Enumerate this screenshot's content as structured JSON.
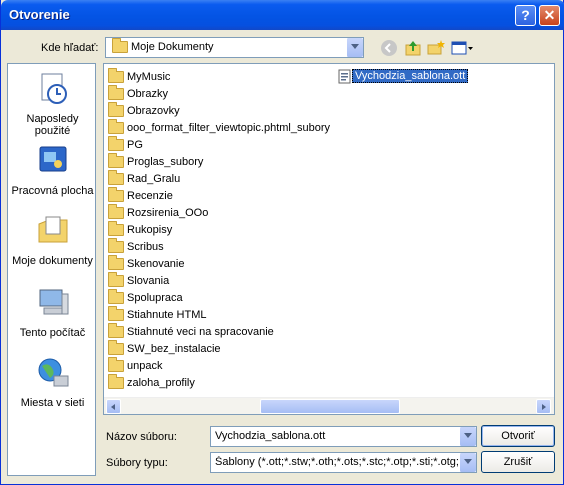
{
  "window": {
    "title": "Otvorenie",
    "help_glyph": "?",
    "close_glyph": "✕"
  },
  "lookin": {
    "label": "Kde hľadať:",
    "value": "Moje Dokumenty"
  },
  "places": [
    {
      "label": "Naposledy použité",
      "icon": "recent-documents-icon"
    },
    {
      "label": "Pracovná plocha",
      "icon": "desktop-icon"
    },
    {
      "label": "Moje dokumenty",
      "icon": "my-documents-icon"
    },
    {
      "label": "Tento počítač",
      "icon": "my-computer-icon"
    },
    {
      "label": "Miesta v sieti",
      "icon": "network-places-icon"
    }
  ],
  "folders": [
    "MyMusic",
    "Obrazky",
    "Obrazovky",
    "ooo_format_filter_viewtopic.phtml_subory",
    "PG",
    "Proglas_subory",
    "Rad_Gralu",
    "Recenzie",
    "Rozsirenia_OOo",
    "Rukopisy",
    "Scribus",
    "Skenovanie",
    "Slovania",
    "Spolupraca",
    "Stiahnute HTML",
    "Stiahnuté veci na spracovanie",
    "SW_bez_instalacie",
    "unpack",
    "zaloha_profily"
  ],
  "selected_file": "Vychodzia_sablona.ott",
  "filename": {
    "label": "Názov súboru:",
    "value": "Vychodzia_sablona.ott"
  },
  "filetype": {
    "label": "Súbory typu:",
    "value": "Šablony (*.ott;*.stw;*.oth;*.ots;*.stc;*.otp;*.sti;*.otg;*.s"
  },
  "buttons": {
    "open": "Otvoriť",
    "cancel": "Zrušiť"
  },
  "colors": {
    "titlebar": "#0A5BEF",
    "selection": "#316AC5"
  }
}
